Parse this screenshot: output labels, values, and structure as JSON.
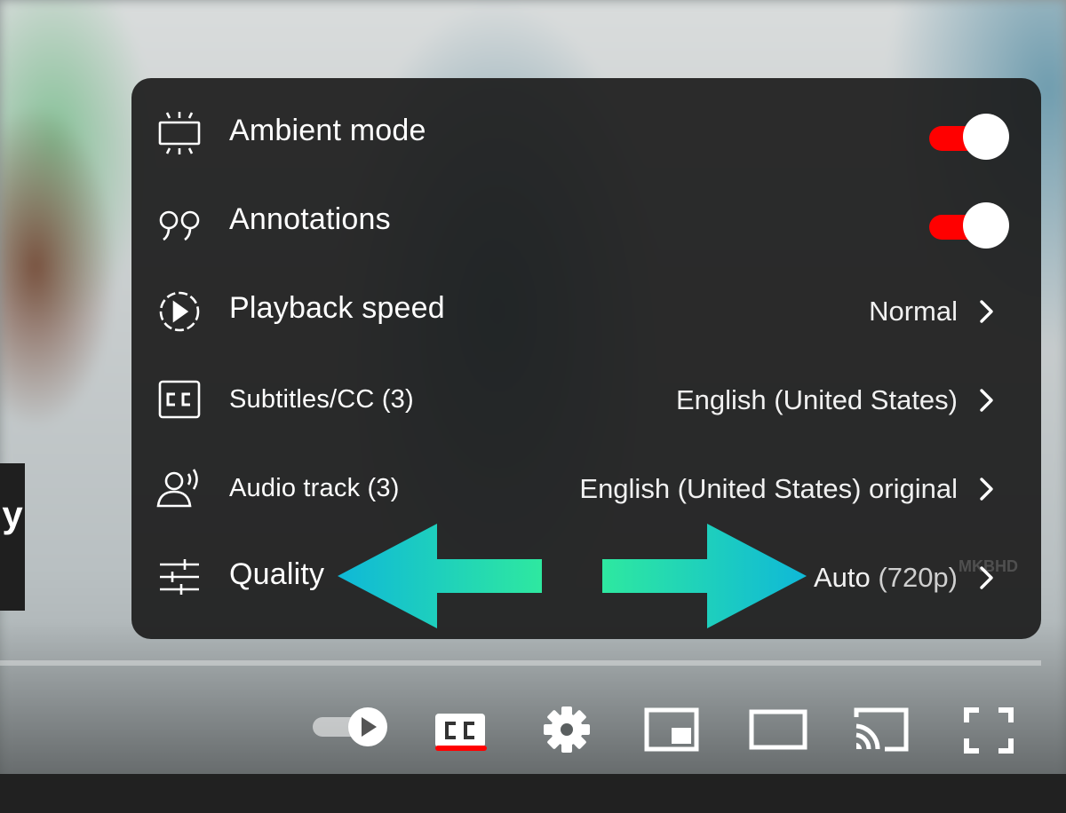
{
  "video": {
    "left_overlay_text": "y",
    "watermark": "MKBHD"
  },
  "settings_menu": {
    "items": [
      {
        "label": "Ambient mode",
        "icon": "ambient-mode-icon",
        "control": "toggle",
        "toggle_on": true
      },
      {
        "label": "Annotations",
        "icon": "annotations-icon",
        "control": "toggle",
        "toggle_on": true
      },
      {
        "label": "Playback speed",
        "icon": "playback-speed-icon",
        "control": "submenu",
        "value": "Normal"
      },
      {
        "label": "Subtitles/CC (3)",
        "icon": "subtitles-icon",
        "control": "submenu",
        "value": "English (United States)"
      },
      {
        "label": "Audio track (3)",
        "icon": "audio-track-icon",
        "control": "submenu",
        "value": "English (United States) original"
      },
      {
        "label": "Quality",
        "icon": "quality-sliders-icon",
        "control": "submenu",
        "value": "Auto",
        "value_detail": "(720p)"
      }
    ]
  },
  "annotation_arrows": {
    "color_start": "#2ee8a0",
    "color_end": "#0fb8d8"
  },
  "player_controls": {
    "buttons": [
      {
        "name": "autoplay-toggle",
        "icon": "autoplay-icon"
      },
      {
        "name": "subtitles-button",
        "icon": "cc-icon",
        "active": true,
        "active_color": "#ff0000"
      },
      {
        "name": "settings-button",
        "icon": "gear-icon"
      },
      {
        "name": "miniplayer-button",
        "icon": "miniplayer-icon"
      },
      {
        "name": "theater-mode-button",
        "icon": "theater-icon"
      },
      {
        "name": "cast-button",
        "icon": "cast-icon"
      },
      {
        "name": "fullscreen-button",
        "icon": "fullscreen-icon"
      }
    ]
  },
  "colors": {
    "toggle_on": "#ff0000",
    "menu_background": "#1c1c1c",
    "text": "#ffffff"
  }
}
